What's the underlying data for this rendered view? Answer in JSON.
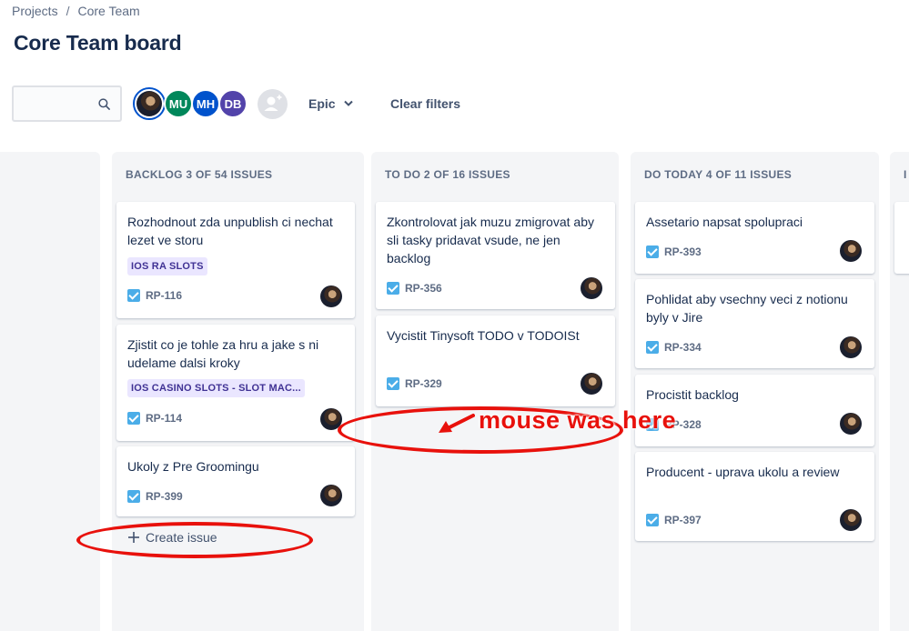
{
  "breadcrumb": {
    "projects": "Projects",
    "separator": "/",
    "current": "Core Team"
  },
  "title": "Core Team board",
  "search": {
    "value": "",
    "placeholder": ""
  },
  "avatars": [
    {
      "initials": "",
      "color": "#ffffff"
    },
    {
      "initials": "MU",
      "color": "#00875a"
    },
    {
      "initials": "MH",
      "color": "#0052cc"
    },
    {
      "initials": "DB",
      "color": "#5243aa"
    }
  ],
  "filters": {
    "epic": "Epic",
    "clear": "Clear filters"
  },
  "columns": [
    {
      "header": "BACKLOG 3 OF 54 ISSUES"
    },
    {
      "header": "TO DO 2 OF 16 ISSUES"
    },
    {
      "header": "DO TODAY 4 OF 11 ISSUES"
    },
    {
      "header": "I"
    }
  ],
  "backlog_cards": [
    {
      "title": "Rozhodnout zda unpublish ci nechat lezet ve storu",
      "epic": "IOS RA SLOTS",
      "key": "RP-116"
    },
    {
      "title": "Zjistit co je tohle za hru a jake s ni udelame dalsi kroky",
      "epic": "IOS CASINO SLOTS - SLOT MAC...",
      "key": "RP-114"
    },
    {
      "title": "Ukoly z Pre Groomingu",
      "key": "RP-399"
    }
  ],
  "todo_cards": [
    {
      "title": "Zkontrolovat jak muzu zmigrovat aby sli tasky pridavat vsude, ne jen backlog",
      "key": "RP-356"
    },
    {
      "title": "Vycistit Tinysoft TODO v TODOISt",
      "key": "RP-329"
    }
  ],
  "today_cards": [
    {
      "title": "Assetario napsat spolupraci",
      "key": "RP-393"
    },
    {
      "title": "Pohlidat aby vsechny veci z notionu byly v Jire",
      "key": "RP-334"
    },
    {
      "title": "Procistit backlog",
      "key": "RP-328"
    },
    {
      "title": "Producent - uprava ukolu a review",
      "key": "RP-397"
    }
  ],
  "create_issue": "Create issue",
  "annotation": {
    "text": "mouse was here",
    "color": "#e8110c"
  }
}
